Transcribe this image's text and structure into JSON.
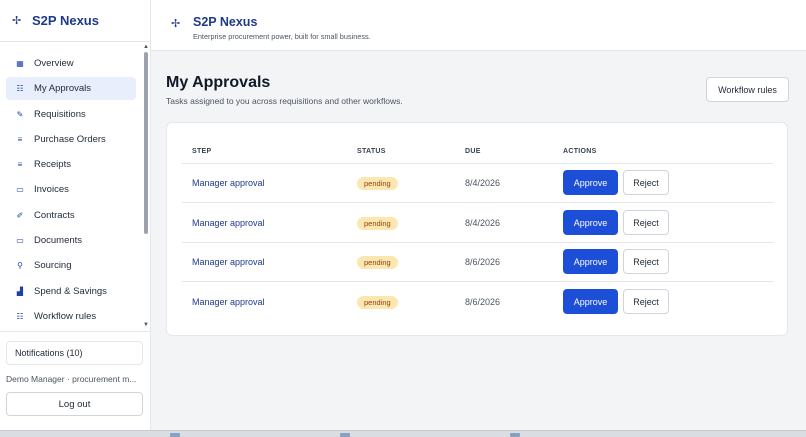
{
  "app": {
    "name": "S2P Nexus",
    "tagline": "Enterprise procurement power, built for small business."
  },
  "sidebar": {
    "items": [
      {
        "label": "Overview",
        "icon": "grid-icon",
        "active": false
      },
      {
        "label": "My Approvals",
        "icon": "checklist-icon",
        "active": true
      },
      {
        "label": "Requisitions",
        "icon": "document-edit-icon",
        "active": false
      },
      {
        "label": "Purchase Orders",
        "icon": "list-icon",
        "active": false
      },
      {
        "label": "Receipts",
        "icon": "list-icon",
        "active": false
      },
      {
        "label": "Invoices",
        "icon": "invoice-icon",
        "active": false
      },
      {
        "label": "Contracts",
        "icon": "contract-icon",
        "active": false
      },
      {
        "label": "Documents",
        "icon": "folder-icon",
        "active": false
      },
      {
        "label": "Sourcing",
        "icon": "sourcing-icon",
        "active": false
      },
      {
        "label": "Spend & Savings",
        "icon": "chart-icon",
        "active": false
      },
      {
        "label": "Workflow rules",
        "icon": "workflow-icon",
        "active": false
      }
    ],
    "notifications": "Notifications (10)",
    "user": "Demo Manager · procurement m...",
    "logout": "Log out"
  },
  "main": {
    "title": "My Approvals",
    "subtitle": "Tasks assigned to you across requisitions and other workflows.",
    "workflow_button": "Workflow rules",
    "table": {
      "headers": {
        "step": "STEP",
        "status": "STATUS",
        "due": "DUE",
        "actions": "ACTIONS"
      },
      "rows": [
        {
          "step": "Manager approval",
          "status": "pending",
          "due": "8/4/2026"
        },
        {
          "step": "Manager approval",
          "status": "pending",
          "due": "8/4/2026"
        },
        {
          "step": "Manager approval",
          "status": "pending",
          "due": "8/6/2026"
        },
        {
          "step": "Manager approval",
          "status": "pending",
          "due": "8/6/2026"
        }
      ],
      "approve_label": "Approve",
      "reject_label": "Reject"
    }
  },
  "colors": {
    "brand": "#1e3a8a",
    "primary": "#1d4ed8",
    "pending_bg": "#fde7b0",
    "pending_text": "#92400e"
  }
}
